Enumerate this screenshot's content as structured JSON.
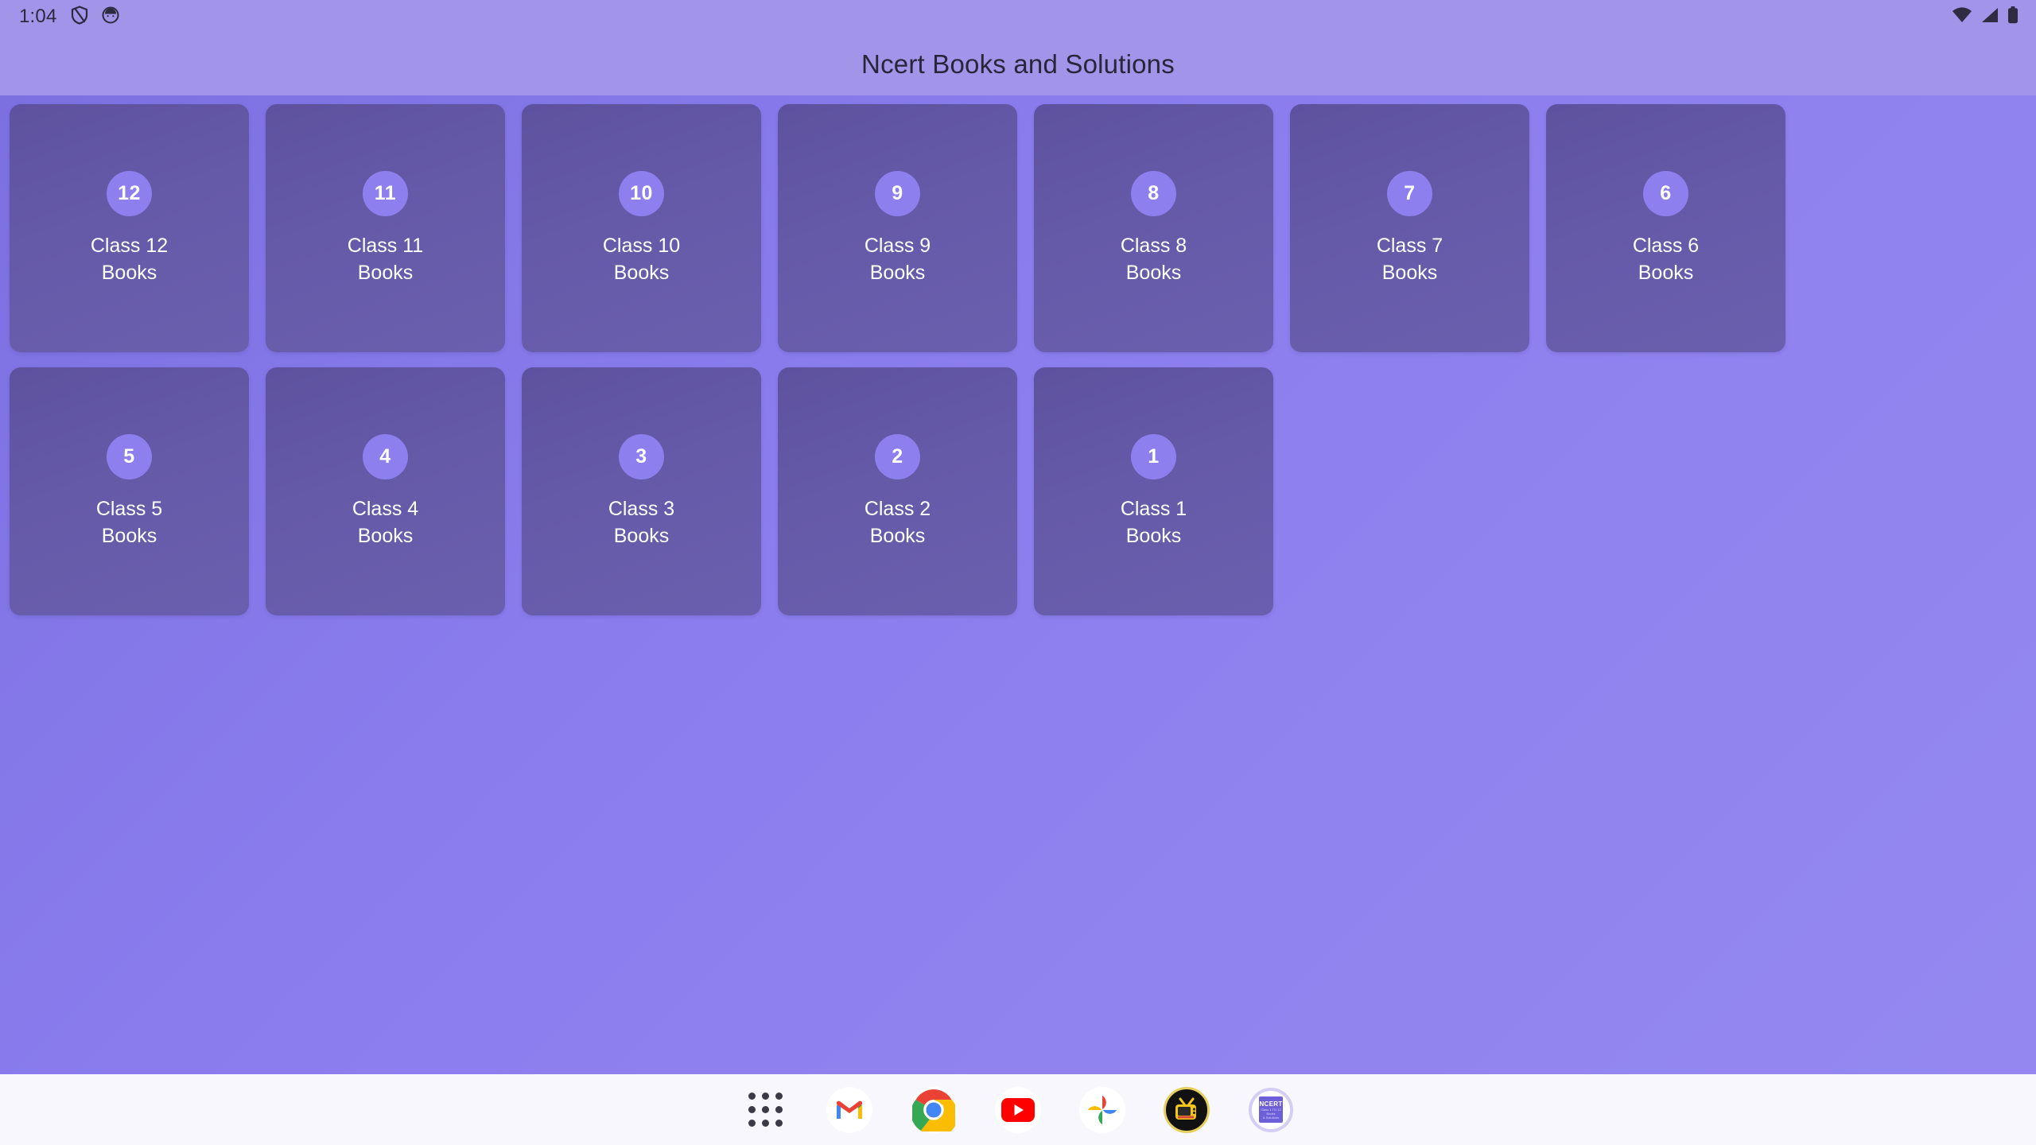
{
  "status_bar": {
    "clock": "1:04",
    "left_icons": [
      {
        "name": "shield-icon",
        "glyph": "shield"
      },
      {
        "name": "face-unlock-icon",
        "glyph": "face"
      }
    ],
    "right_icons": [
      {
        "name": "wifi-icon",
        "glyph": "wifi"
      },
      {
        "name": "cellular-signal-icon",
        "glyph": "signal"
      },
      {
        "name": "battery-icon",
        "glyph": "battery"
      }
    ]
  },
  "app_bar": {
    "title": "Ncert Books and Solutions"
  },
  "colors": {
    "status_bar_bg": "#a294e8",
    "app_bar_bg": "#a294e8",
    "page_bg_start": "#7b6fe0",
    "page_bg_end": "#9488f0",
    "card_bg": "#655aa8",
    "badge_bg": "#8d7fed",
    "card_text": "#ffffff",
    "title_text": "#282638",
    "dock_bg": "#f8f7fd"
  },
  "grid": {
    "cards": [
      {
        "badge": "12",
        "line1": "Class 12",
        "line2": "Books"
      },
      {
        "badge": "11",
        "line1": "Class 11",
        "line2": "Books"
      },
      {
        "badge": "10",
        "line1": "Class 10",
        "line2": "Books"
      },
      {
        "badge": "9",
        "line1": "Class 9",
        "line2": "Books"
      },
      {
        "badge": "8",
        "line1": "Class 8",
        "line2": "Books"
      },
      {
        "badge": "7",
        "line1": "Class 7",
        "line2": "Books"
      },
      {
        "badge": "6",
        "line1": "Class 6",
        "line2": "Books"
      },
      {
        "badge": "5",
        "line1": "Class 5",
        "line2": "Books"
      },
      {
        "badge": "4",
        "line1": "Class 4",
        "line2": "Books"
      },
      {
        "badge": "3",
        "line1": "Class 3",
        "line2": "Books"
      },
      {
        "badge": "2",
        "line1": "Class 2",
        "line2": "Books"
      },
      {
        "badge": "1",
        "line1": "Class 1",
        "line2": "Books"
      }
    ]
  },
  "dock": {
    "items": [
      {
        "name": "app-drawer-icon",
        "label": "All apps"
      },
      {
        "name": "gmail-icon",
        "label": "Gmail"
      },
      {
        "name": "chrome-icon",
        "label": "Chrome"
      },
      {
        "name": "youtube-icon",
        "label": "YouTube"
      },
      {
        "name": "google-photos-icon",
        "label": "Photos"
      },
      {
        "name": "tv-app-icon",
        "label": "TV App"
      },
      {
        "name": "ncert-app-icon",
        "label": "NCERT"
      }
    ],
    "ncert_icon_text": {
      "title": "NCERT",
      "sub1": "Class 1 TO 12",
      "sub2": "Books",
      "sub3": "& Solutions"
    }
  }
}
